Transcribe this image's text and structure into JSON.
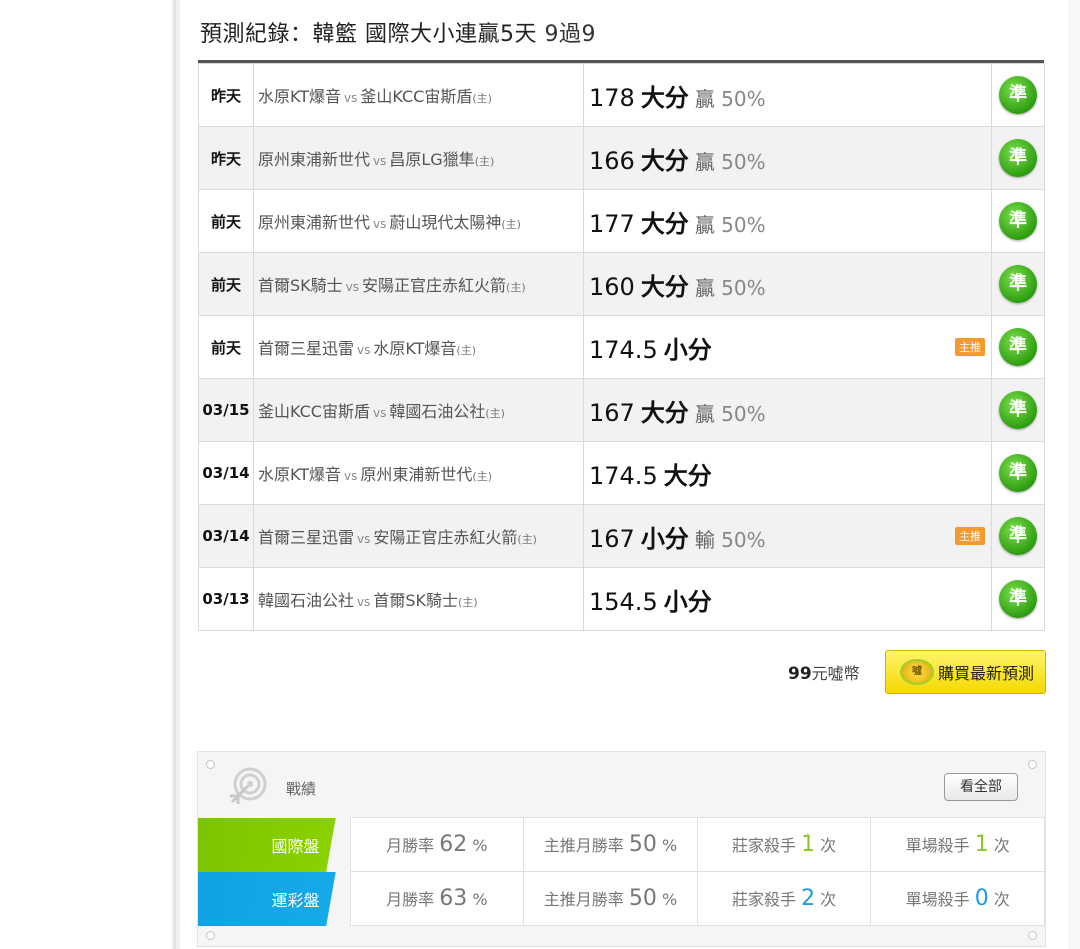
{
  "header": {
    "title_prefix": "預測紀錄：韓籃 國際大小連贏5天 ",
    "title_streak": "9過9"
  },
  "records": [
    {
      "date": "昨天",
      "away": "水原KT爆音",
      "vs": "vs",
      "home": "釜山KCC宙斯盾",
      "home_tag": "(主)",
      "line": "178",
      "pick": "大分",
      "result": "贏",
      "pct": "50%",
      "badge": "",
      "acc": "準"
    },
    {
      "date": "昨天",
      "away": "原州東浦新世代",
      "vs": "vs",
      "home": "昌原LG獵隼",
      "home_tag": "(主)",
      "line": "166",
      "pick": "大分",
      "result": "贏",
      "pct": "50%",
      "badge": "",
      "acc": "準"
    },
    {
      "date": "前天",
      "away": "原州東浦新世代",
      "vs": "vs",
      "home": "蔚山現代太陽神",
      "home_tag": "(主)",
      "line": "177",
      "pick": "大分",
      "result": "贏",
      "pct": "50%",
      "badge": "",
      "acc": "準"
    },
    {
      "date": "前天",
      "away": "首爾SK騎士",
      "vs": "vs",
      "home": "安陽正官庄赤紅火箭",
      "home_tag": "(主)",
      "line": "160",
      "pick": "大分",
      "result": "贏",
      "pct": "50%",
      "badge": "",
      "acc": "準"
    },
    {
      "date": "前天",
      "away": "首爾三星迅雷",
      "vs": "vs",
      "home": "水原KT爆音",
      "home_tag": "(主)",
      "line": "174.5",
      "pick": "小分",
      "result": "",
      "pct": "",
      "badge": "主推",
      "acc": "準"
    },
    {
      "date": "03/15",
      "away": "釜山KCC宙斯盾",
      "vs": "vs",
      "home": "韓國石油公社",
      "home_tag": "(主)",
      "line": "167",
      "pick": "大分",
      "result": "贏",
      "pct": "50%",
      "badge": "",
      "acc": "準"
    },
    {
      "date": "03/14",
      "away": "水原KT爆音",
      "vs": "vs",
      "home": "原州東浦新世代",
      "home_tag": "(主)",
      "line": "174.5",
      "pick": "大分",
      "result": "",
      "pct": "",
      "badge": "",
      "acc": "準"
    },
    {
      "date": "03/14",
      "away": "首爾三星迅雷",
      "vs": "vs",
      "home": "安陽正官庄赤紅火箭",
      "home_tag": "(主)",
      "line": "167",
      "pick": "小分",
      "result": "輸",
      "pct": "50%",
      "badge": "主推",
      "acc": "準"
    },
    {
      "date": "03/13",
      "away": "韓國石油公社",
      "vs": "vs",
      "home": "首爾SK騎士",
      "home_tag": "(主)",
      "line": "154.5",
      "pick": "小分",
      "result": "",
      "pct": "",
      "badge": "",
      "acc": "準"
    }
  ],
  "purchase": {
    "price_num": "99",
    "price_unit": "元噓幣",
    "coin_text": "噓",
    "button_label": "購買最新預測"
  },
  "stats": {
    "label": "戰績",
    "view_all": "看全部",
    "rows": [
      {
        "category": "國際盤",
        "month_label": "月勝率",
        "month_rate": "62",
        "month_unit": "%",
        "main_label": "主推月勝率",
        "main_rate": "50",
        "main_unit": "%",
        "banker_label": "莊家殺手",
        "banker_count": "1",
        "banker_unit": "次",
        "single_label": "單場殺手",
        "single_count": "1",
        "single_unit": "次"
      },
      {
        "category": "運彩盤",
        "month_label": "月勝率",
        "month_rate": "63",
        "month_unit": "%",
        "main_label": "主推月勝率",
        "main_rate": "50",
        "main_unit": "%",
        "banker_label": "莊家殺手",
        "banker_count": "2",
        "banker_unit": "次",
        "single_label": "單場殺手",
        "single_count": "0",
        "single_unit": "次"
      }
    ]
  },
  "colors": {
    "accent_green": "#88c926",
    "accent_blue": "#1d9be0",
    "accent_orange": "#f39b3a",
    "button_yellow": "#f5d800"
  }
}
